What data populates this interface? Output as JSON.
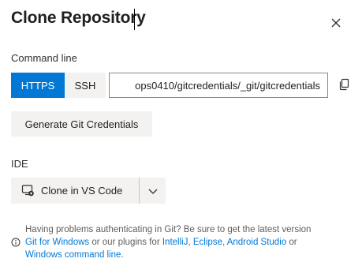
{
  "dialog": {
    "title": "Clone Repository"
  },
  "command_line": {
    "label": "Command line",
    "protocols": [
      "HTTPS",
      "SSH"
    ],
    "selected_protocol": "HTTPS",
    "url_value": "ops0410/gitcredentials/_git/gitcredentials",
    "generate_button": "Generate Git Credentials"
  },
  "ide": {
    "label": "IDE",
    "clone_button": "Clone in VS Code"
  },
  "help": {
    "text_1": "Having problems authenticating in Git? Be sure to get the latest version",
    "link_git_windows": "Git for Windows",
    "text_2": " or our plugins for ",
    "link_intellij": "IntelliJ",
    "text_3": ", ",
    "link_eclipse": "Eclipse",
    "text_4": ", ",
    "link_android_studio": "Android Studio",
    "text_5": " or ",
    "link_windows_cmd": "Windows command line",
    "text_6": "."
  },
  "colors": {
    "accent": "#0078d4",
    "button_bg": "#f3f2f1",
    "border": "#8a8886",
    "muted_text": "#605e5c"
  },
  "icons": {
    "close": "close-icon",
    "copy": "copy-icon",
    "vscode": "vscode-icon",
    "dropdown": "chevron-down-icon",
    "info": "info-icon"
  }
}
